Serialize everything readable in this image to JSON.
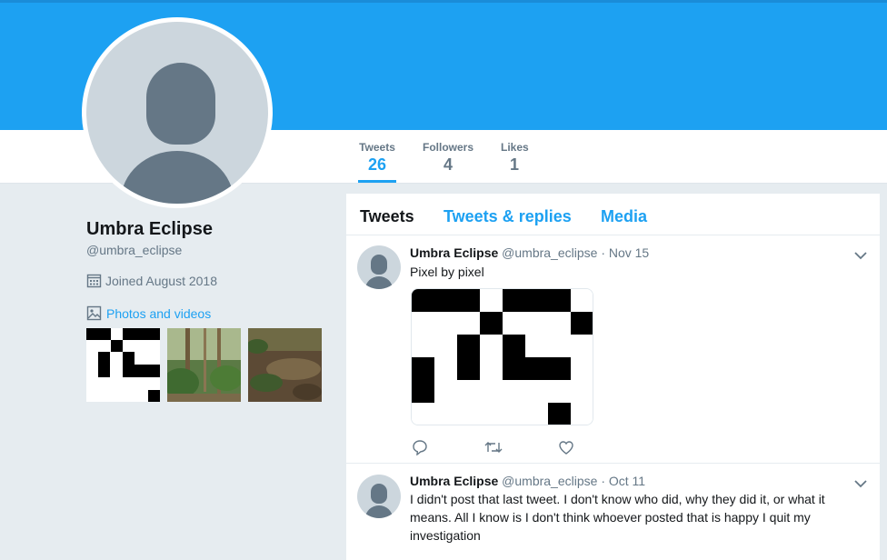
{
  "profile": {
    "name": "Umbra Eclipse",
    "handle": "@umbra_eclipse",
    "joined": "Joined August 2018",
    "photos_link": "Photos and videos"
  },
  "stats": [
    {
      "label": "Tweets",
      "value": "26"
    },
    {
      "label": "Followers",
      "value": "4"
    },
    {
      "label": "Likes",
      "value": "1"
    }
  ],
  "tabs": [
    "Tweets",
    "Tweets & replies",
    "Media"
  ],
  "tweets": [
    {
      "name": "Umbra Eclipse",
      "handle": "@umbra_eclipse",
      "date": "· Nov 15",
      "text": "Pixel by pixel"
    },
    {
      "name": "Umbra Eclipse",
      "handle": "@umbra_eclipse",
      "date": "· Oct 11",
      "text": "I didn't post that last tweet. I don't know who did, why they did it, or what it means. All I know is I don't think whoever posted that is happy I quit my investigation"
    }
  ],
  "colors": {
    "accent": "#1da1f2",
    "secondary_text": "#657786",
    "background": "#e6ecf0"
  },
  "icons": [
    "calendar-icon",
    "photo-icon",
    "chevron-down-icon",
    "reply-icon",
    "retweet-icon",
    "like-icon"
  ]
}
